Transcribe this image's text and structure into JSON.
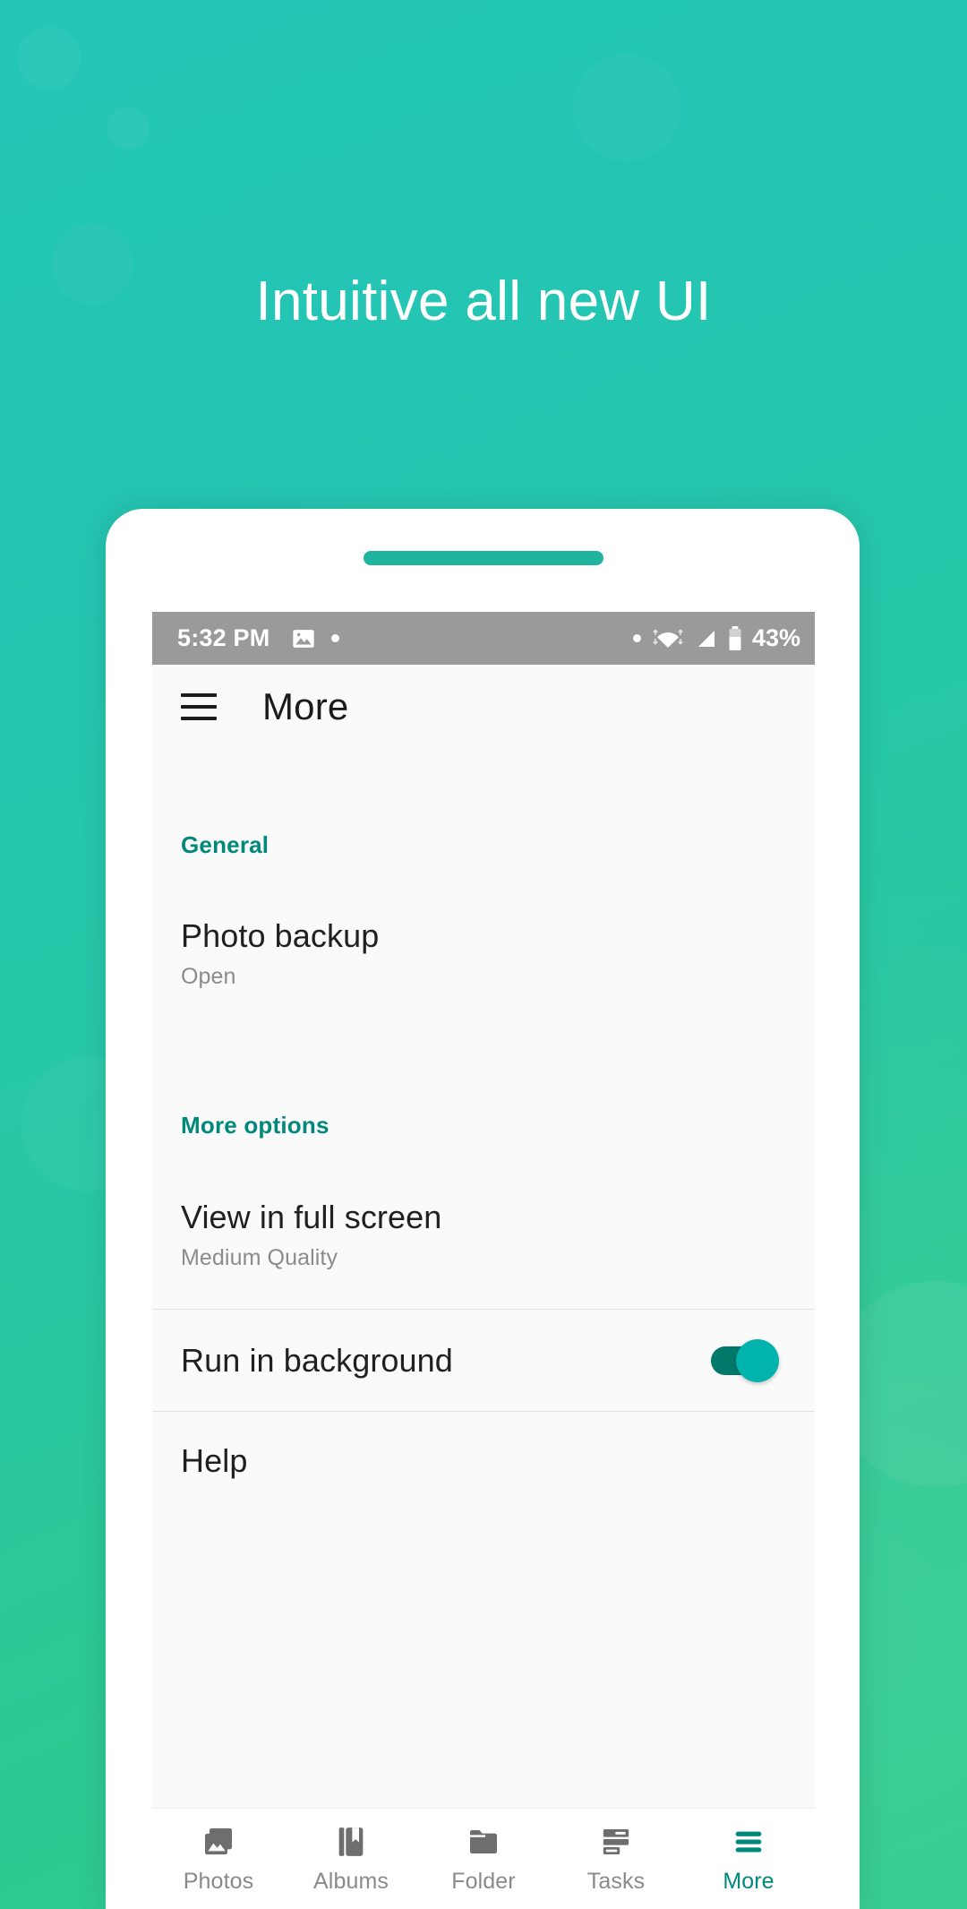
{
  "promo": {
    "headline": "Intuitive all new UI",
    "background_color_start": "#25c6b8",
    "background_color_end": "#2ecb8c"
  },
  "phone": {
    "speaker_color": "#20b49e"
  },
  "statusbar": {
    "time": "5:32 PM",
    "left_icons": [
      "image-icon",
      "dot-icon"
    ],
    "right_icons": [
      "dot-icon",
      "wifi-icon",
      "signal-icon",
      "battery-icon"
    ],
    "battery_percent": "43%",
    "background_color": "#9a9a9a"
  },
  "appbar": {
    "menu_icon": "hamburger-icon",
    "title": "More"
  },
  "sections": [
    {
      "header": "General",
      "items": [
        {
          "title": "Photo backup",
          "subtitle": "Open"
        }
      ]
    },
    {
      "header": "More options",
      "items": [
        {
          "title": "View in full screen",
          "subtitle": "Medium Quality"
        }
      ]
    }
  ],
  "toggle_row": {
    "title": "Run in background",
    "state": "on",
    "track_color": "#00796b",
    "thumb_color": "#00b3ac"
  },
  "help_row": {
    "title": "Help"
  },
  "bottom_nav": {
    "active_color": "#00897b",
    "inactive_color": "#8a8a8a",
    "items": [
      {
        "label": "Photos",
        "icon": "photos-icon",
        "active": false
      },
      {
        "label": "Albums",
        "icon": "albums-icon",
        "active": false
      },
      {
        "label": "Folder",
        "icon": "folder-icon",
        "active": false
      },
      {
        "label": "Tasks",
        "icon": "tasks-icon",
        "active": false
      },
      {
        "label": "More",
        "icon": "more-icon",
        "active": true
      }
    ]
  }
}
